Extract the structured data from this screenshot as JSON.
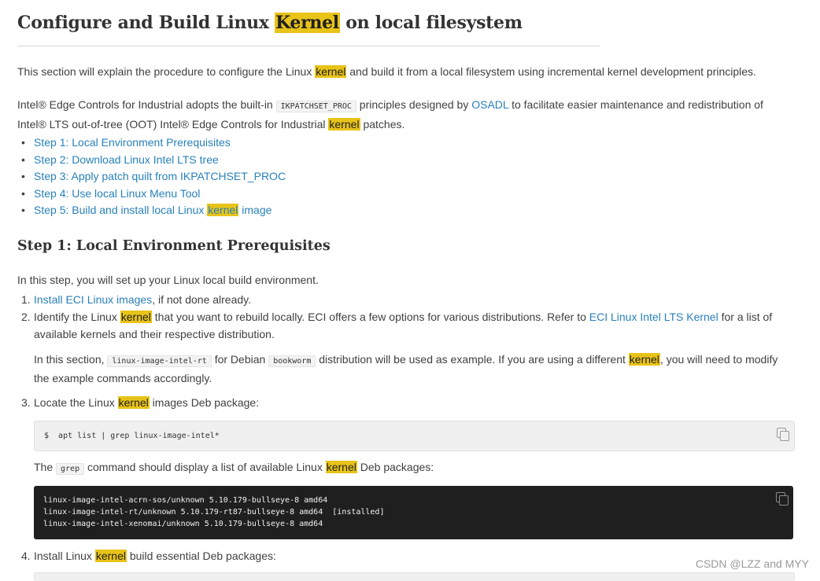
{
  "title": {
    "before": "Configure and Build Linux ",
    "highlight": "Kernel",
    "after": " on local filesystem"
  },
  "intro": {
    "before": "This section will explain the procedure to configure the Linux ",
    "highlight": "kernel",
    "after": " and build it from a local filesystem using incremental kernel development principles."
  },
  "intro2": {
    "part1": "Intel® Edge Controls for Industrial adopts the built-in ",
    "code": "IKPATCHSET_PROC",
    "part2": " principles designed by ",
    "link": "OSADL",
    "part3": " to facilitate easier maintenance and redistribution of",
    "line2_before": "Intel® LTS out-of-tree (OOT) Intel® Edge Controls for Industrial ",
    "line2_highlight": "kernel",
    "line2_after": " patches."
  },
  "toc": [
    {
      "label": "Step 1: Local Environment Prerequisites"
    },
    {
      "label": "Step 2: Download Linux Intel LTS tree"
    },
    {
      "label": "Step 3: Apply patch quilt from IKPATCHSET_PROC"
    },
    {
      "label": "Step 4: Use local Linux Menu Tool"
    },
    {
      "label_before": "Step 5: Build and install local Linux ",
      "label_highlight": "kernel",
      "label_after": " image"
    }
  ],
  "step1": {
    "heading": "Step 1: Local Environment Prerequisites",
    "intro": "In this step, you will set up your Linux local build environment.",
    "items": {
      "i1": {
        "num": "1.",
        "link": "Install ECI Linux images",
        "after": ", if not done already."
      },
      "i2": {
        "num": "2.",
        "before": "Identify the Linux ",
        "highlight": "kernel",
        "mid": " that you want to rebuild locally. ECI offers a few options for various distributions. Refer to ",
        "link": "ECI Linux Intel LTS Kernel",
        "after": " for a list of",
        "line2": "available kernels and their respective distribution.",
        "note_before": "In this section, ",
        "note_code1": "linux-image-intel-rt",
        "note_mid": " for Debian ",
        "note_code2": "bookworm",
        "note_mid2": " distribution will be used as example. If you are using a different ",
        "note_highlight": "kernel",
        "note_after": ", you will need to modify",
        "note_line2": "the example commands accordingly."
      },
      "i3": {
        "num": "3.",
        "before": "Locate the Linux ",
        "highlight": "kernel",
        "after": " images Deb package:",
        "command": "$  apt list | grep linux-image-intel*",
        "desc_before": "The ",
        "desc_code": "grep",
        "desc_mid": " command should display a list of available Linux ",
        "desc_highlight": "kernel",
        "desc_after": " Deb packages:",
        "output": [
          "linux-image-intel-acrn-sos/unknown 5.10.179-bullseye-8 amd64",
          "linux-image-intel-rt/unknown 5.10.179-rt87-bullseye-8 amd64  [installed]",
          "linux-image-intel-xenomai/unknown 5.10.179-bullseye-8 amd64"
        ]
      },
      "i4": {
        "num": "4.",
        "before": "Install Linux ",
        "highlight": "kernel",
        "after": " build essential Deb packages:"
      }
    }
  },
  "watermark": "CSDN @LZZ and MYY",
  "colors": {
    "highlight": "#e8c318",
    "link": "#2980b9",
    "code_dark_bg": "#1f1f1f",
    "code_light_bg": "#f0f0f0"
  }
}
